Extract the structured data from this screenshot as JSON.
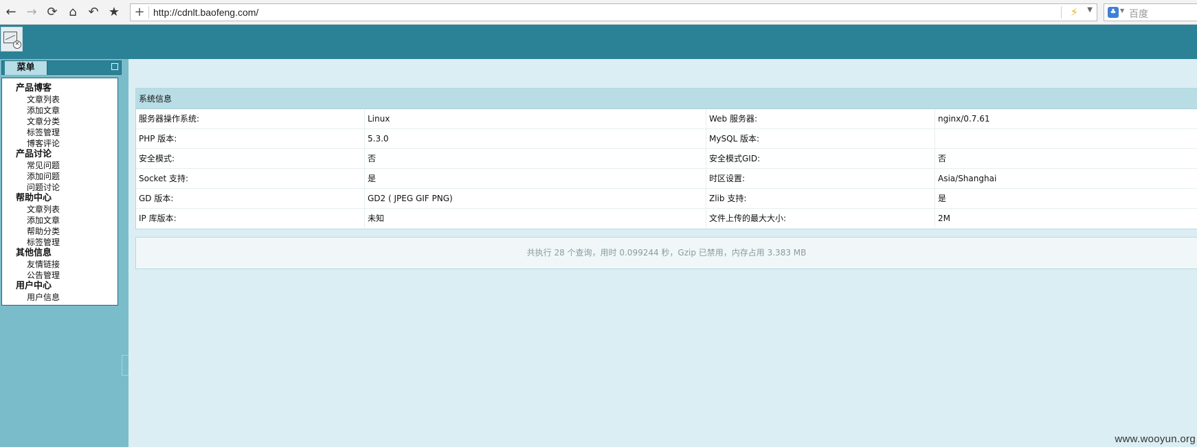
{
  "browser": {
    "url": "http://cdnlt.baofeng.com/",
    "search_placeholder": "百度",
    "nav_icons": [
      "back-icon",
      "forward-icon",
      "refresh-icon",
      "home-icon",
      "undo-icon",
      "star-icon"
    ]
  },
  "sidebar": {
    "menu_title": "菜单",
    "groups": [
      {
        "title": "产品博客",
        "items": [
          "文章列表",
          "添加文章",
          "文章分类",
          "标签管理",
          "博客评论"
        ]
      },
      {
        "title": "产品讨论",
        "items": [
          "常见问题",
          "添加问题",
          "问题讨论"
        ]
      },
      {
        "title": "帮助中心",
        "items": [
          "文章列表",
          "添加文章",
          "帮助分类",
          "标签管理"
        ]
      },
      {
        "title": "其他信息",
        "items": [
          "友情链接",
          "公告管理"
        ]
      },
      {
        "title": "用户中心",
        "items": [
          "用户信息"
        ]
      }
    ]
  },
  "system_info": {
    "title": "系统信息",
    "rows": [
      [
        "服务器操作系统:",
        "Linux",
        "Web 服务器:",
        "nginx/0.7.61"
      ],
      [
        "PHP 版本:",
        "5.3.0",
        "MySQL 版本:",
        ""
      ],
      [
        "安全模式:",
        "否",
        "安全模式GID:",
        "否"
      ],
      [
        "Socket 支持:",
        "是",
        "时区设置:",
        "Asia/Shanghai"
      ],
      [
        "GD 版本:",
        "GD2 ( JPEG GIF PNG)",
        "Zlib 支持:",
        "是"
      ],
      [
        "IP 库版本:",
        "未知",
        "文件上传的最大大小:",
        "2M"
      ]
    ]
  },
  "footer_stats": "共执行 28 个查询，用时 0.099244 秒，Gzip 已禁用，内存占用 3.383 MB",
  "watermark": "www.wooyun.org",
  "colors": {
    "header": "#2b8296",
    "sidebar": "#7bbccb",
    "content_bg": "#dbeef3",
    "table_head": "#b9dde5"
  }
}
